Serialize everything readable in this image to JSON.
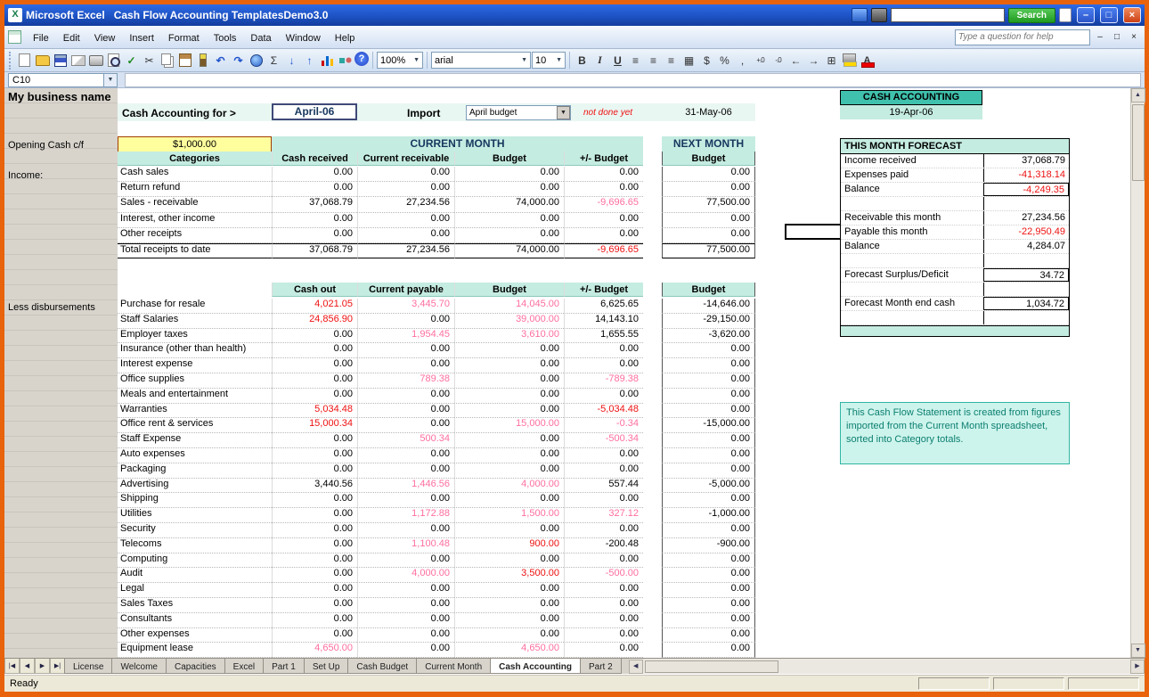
{
  "window": {
    "title": "Microsoft Excel   Cash Flow Accounting TemplatesDemo3.0",
    "green_button_label": "Search"
  },
  "menu": {
    "items": [
      "File",
      "Edit",
      "View",
      "Insert",
      "Format",
      "Tools",
      "Data",
      "Window",
      "Help"
    ],
    "help_placeholder": "Type a question for help"
  },
  "toolbar": {
    "font_name": "arial",
    "font_size": "10",
    "zoom": "100%",
    "standard_icons": [
      "new-icon",
      "open-icon",
      "save-icon",
      "mail-icon",
      "print-icon",
      "print-preview-icon",
      "spelling-icon",
      "cut-icon",
      "copy-icon",
      "paste-icon",
      "format-painter-icon",
      "undo-icon",
      "redo-icon",
      "hyperlink-icon",
      "autosum-icon",
      "sort-ascending-icon",
      "sort-descending-icon",
      "chart-wizard-icon",
      "drawing-icon",
      "help-icon"
    ],
    "formatting_icons": [
      "bold-icon",
      "italic-icon",
      "underline-icon",
      "align-left-icon",
      "align-center-icon",
      "align-right-icon",
      "merge-center-icon",
      "currency-icon",
      "percent-icon",
      "comma-icon",
      "increase-decimal-icon",
      "decrease-decimal-icon",
      "decrease-indent-icon",
      "increase-indent-icon",
      "borders-icon",
      "fill-color-icon",
      "font-color-icon"
    ]
  },
  "formula_bar": {
    "name_box": "C10"
  },
  "sheet": {
    "business_name": "My business name",
    "header": {
      "cash_accounting_for": "Cash Accounting for >",
      "month": "April-06",
      "import_label": "Import",
      "import_value": "April budget",
      "import_note": "not done yet",
      "next_month_date": "31-May-06",
      "section_title": "CASH ACCOUNTING",
      "report_date": "19-Apr-06"
    },
    "opening_cash": {
      "label": "Opening Cash c/f",
      "value": "$1,000.00"
    },
    "banners": {
      "current_month": "CURRENT MONTH",
      "next_month": "NEXT MONTH"
    },
    "group_labels": {
      "income": "Income:",
      "disbursements": "Less disbursements"
    },
    "income_table": {
      "headers": [
        "Categories",
        "Cash received",
        "Current receivable",
        "Budget",
        "+/- Budget"
      ],
      "next_header": "Budget",
      "rows": [
        {
          "label": "Cash sales",
          "cells": [
            "0.00",
            "0.00",
            "0.00",
            "0.00"
          ],
          "next": "0.00"
        },
        {
          "label": "Return refund",
          "cells": [
            "0.00",
            "0.00",
            "0.00",
            "0.00"
          ],
          "next": "0.00"
        },
        {
          "label": "Sales - receivable",
          "cells": [
            "37,068.79",
            "27,234.56",
            "74,000.00",
            "p:-9,696.65"
          ],
          "next": "77,500.00"
        },
        {
          "label": "Interest, other income",
          "cells": [
            "0.00",
            "0.00",
            "0.00",
            "0.00"
          ],
          "next": "0.00"
        },
        {
          "label": "Other receipts",
          "cells": [
            "0.00",
            "0.00",
            "0.00",
            "0.00"
          ],
          "next": "0.00"
        },
        {
          "label": "Total receipts to date",
          "cells": [
            "37,068.79",
            "27,234.56",
            "74,000.00",
            "r:-9,696.65"
          ],
          "next": "77,500.00",
          "total": true
        }
      ]
    },
    "disbursements_table": {
      "headers": [
        "",
        "Cash out",
        "Current payable",
        "Budget",
        "+/- Budget"
      ],
      "next_header": "Budget",
      "rows": [
        {
          "label": "Purchase for resale",
          "cells": [
            "r:4,021.05",
            "p:3,445.70",
            "p:14,045.00",
            "6,625.65"
          ],
          "next": "-14,646.00"
        },
        {
          "label": "Staff Salaries",
          "cells": [
            "r:24,856.90",
            "0.00",
            "p:39,000.00",
            "14,143.10"
          ],
          "next": "-29,150.00"
        },
        {
          "label": "Employer taxes",
          "cells": [
            "0.00",
            "p:1,954.45",
            "p:3,610.00",
            "1,655.55"
          ],
          "next": "-3,620.00"
        },
        {
          "label": "Insurance (other than health)",
          "cells": [
            "0.00",
            "0.00",
            "0.00",
            "0.00"
          ],
          "next": "0.00"
        },
        {
          "label": "Interest expense",
          "cells": [
            "0.00",
            "0.00",
            "0.00",
            "0.00"
          ],
          "next": "0.00"
        },
        {
          "label": "Office supplies",
          "cells": [
            "0.00",
            "p:789.38",
            "0.00",
            "p:-789.38"
          ],
          "next": "0.00"
        },
        {
          "label": "Meals and entertainment",
          "cells": [
            "0.00",
            "0.00",
            "0.00",
            "0.00"
          ],
          "next": "0.00"
        },
        {
          "label": "Warranties",
          "cells": [
            "r:5,034.48",
            "0.00",
            "0.00",
            "r:-5,034.48"
          ],
          "next": "0.00"
        },
        {
          "label": "Office rent & services",
          "cells": [
            "r:15,000.34",
            "0.00",
            "p:15,000.00",
            "p:-0.34"
          ],
          "next": "-15,000.00"
        },
        {
          "label": "Staff Expense",
          "cells": [
            "0.00",
            "p:500.34",
            "0.00",
            "p:-500.34"
          ],
          "next": "0.00"
        },
        {
          "label": "Auto expenses",
          "cells": [
            "0.00",
            "0.00",
            "0.00",
            "0.00"
          ],
          "next": "0.00"
        },
        {
          "label": "Packaging",
          "cells": [
            "0.00",
            "0.00",
            "0.00",
            "0.00"
          ],
          "next": "0.00"
        },
        {
          "label": "Advertising",
          "cells": [
            "3,440.56",
            "p:1,446.56",
            "p:4,000.00",
            "557.44"
          ],
          "next": "-5,000.00"
        },
        {
          "label": "Shipping",
          "cells": [
            "0.00",
            "0.00",
            "0.00",
            "0.00"
          ],
          "next": "0.00"
        },
        {
          "label": "Utilities",
          "cells": [
            "0.00",
            "p:1,172.88",
            "p:1,500.00",
            "p:327.12"
          ],
          "next": "-1,000.00"
        },
        {
          "label": "Security",
          "cells": [
            "0.00",
            "0.00",
            "0.00",
            "0.00"
          ],
          "next": "0.00"
        },
        {
          "label": "Telecoms",
          "cells": [
            "0.00",
            "p:1,100.48",
            "r:900.00",
            "-200.48"
          ],
          "next": "-900.00"
        },
        {
          "label": "Computing",
          "cells": [
            "0.00",
            "0.00",
            "0.00",
            "0.00"
          ],
          "next": "0.00"
        },
        {
          "label": "Audit",
          "cells": [
            "0.00",
            "p:4,000.00",
            "r:3,500.00",
            "p:-500.00"
          ],
          "next": "0.00"
        },
        {
          "label": "Legal",
          "cells": [
            "0.00",
            "0.00",
            "0.00",
            "0.00"
          ],
          "next": "0.00"
        },
        {
          "label": "Sales Taxes",
          "cells": [
            "0.00",
            "0.00",
            "0.00",
            "0.00"
          ],
          "next": "0.00"
        },
        {
          "label": "Consultants",
          "cells": [
            "0.00",
            "0.00",
            "0.00",
            "0.00"
          ],
          "next": "0.00"
        },
        {
          "label": "Other expenses",
          "cells": [
            "0.00",
            "0.00",
            "0.00",
            "0.00"
          ],
          "next": "0.00"
        },
        {
          "label": "Equipment lease",
          "cells": [
            "p:4,650.00",
            "0.00",
            "p:4,650.00",
            "0.00"
          ],
          "next": "0.00"
        }
      ]
    },
    "forecast": {
      "title": "THIS MONTH FORECAST",
      "rows": [
        {
          "label": "Income received",
          "value": "37,068.79"
        },
        {
          "label": "Expenses paid",
          "value": "-41,318.14",
          "color": "red"
        },
        {
          "label": "Balance",
          "value": "-4,249.35",
          "color": "red",
          "boxed": true
        },
        {
          "spacer": true
        },
        {
          "label": "Receivable this month",
          "value": "27,234.56"
        },
        {
          "label": "Payable this month",
          "value": "-22,950.49",
          "color": "red"
        },
        {
          "label": "Balance",
          "value": "4,284.07"
        },
        {
          "spacer": true
        },
        {
          "label": "Forecast Surplus/Deficit",
          "value": "34.72",
          "boxed": true
        },
        {
          "spacer": true
        },
        {
          "label": "Forecast Month end cash",
          "value": "1,034.72",
          "boxed": true
        },
        {
          "spacer": true
        }
      ]
    },
    "note": "This Cash Flow Statement is created from figures imported from the Current Month spreadsheet, sorted into Category totals."
  },
  "tabs": {
    "items": [
      "License",
      "Welcome",
      "Capacities",
      "Excel",
      "Part 1",
      "Set Up",
      "Cash Budget",
      "Current Month",
      "Cash Accounting",
      "Part 2"
    ],
    "active": "Cash Accounting"
  },
  "status": {
    "message": "Ready"
  },
  "colors": {
    "teal_header": "#3fc1ad",
    "teal_light": "#c5ece1",
    "red": "#ee1111",
    "pink": "#ff6e9e",
    "yellow_cell": "#ffff9e",
    "frame_orange": "#e8630c"
  }
}
